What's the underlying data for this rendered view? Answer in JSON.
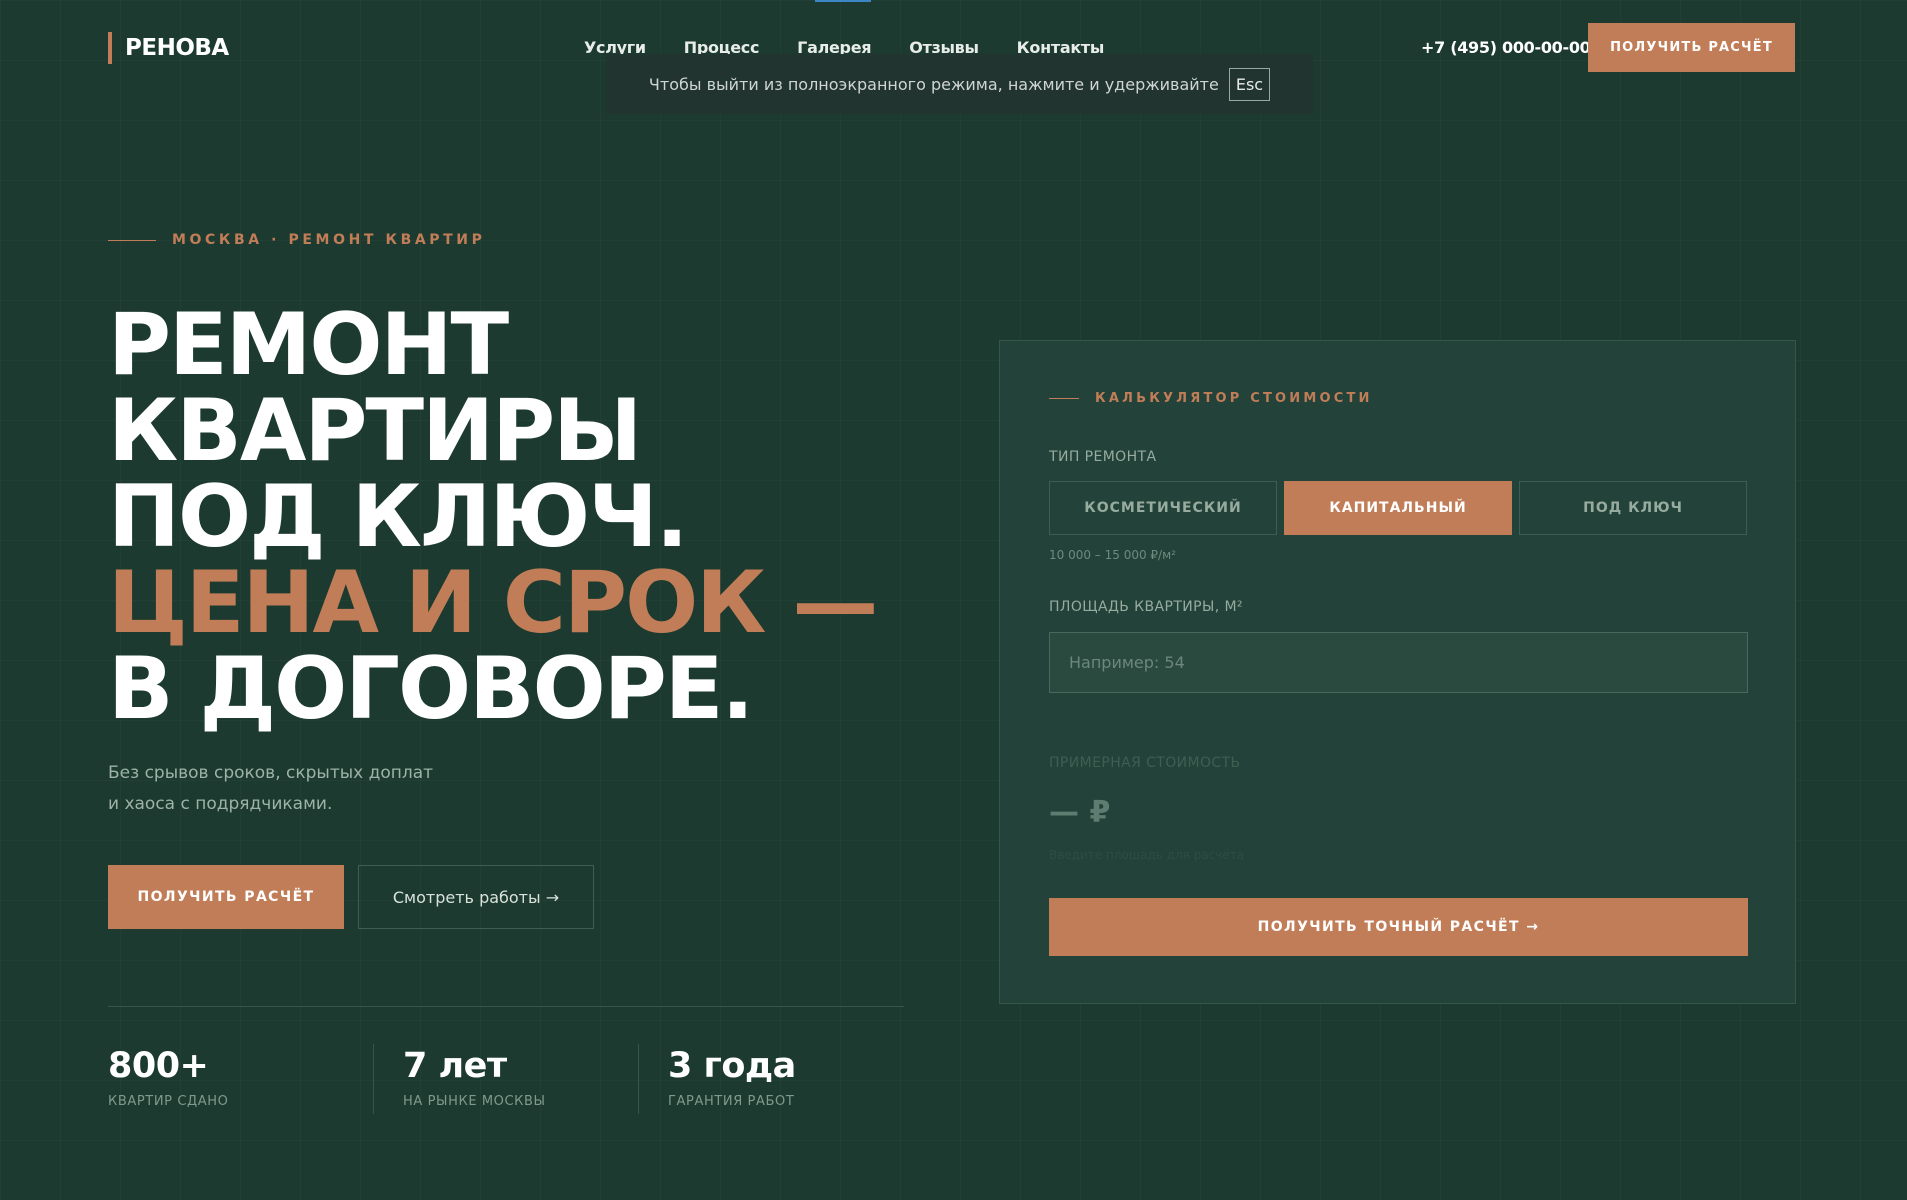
{
  "header": {
    "logo": "РЕНОВА",
    "nav": [
      "Услуги",
      "Процесс",
      "Галерея",
      "Отзывы",
      "Контакты"
    ],
    "phone": "+7 (495) 000-00-00",
    "cta_label": "получить расчёт"
  },
  "fullscreen_notice": {
    "text": "Чтобы выйти из полноэкранного режима, нажмите и удерживайте",
    "key": "Esc"
  },
  "hero": {
    "eyebrow": "Москва · ремонт квартир",
    "headline_lines": [
      "Ремонт",
      "квартиры",
      "под ключ."
    ],
    "headline_accent": "Цена и срок —",
    "headline_last": "в договоре.",
    "subtitle_line1": "Без срывов сроков, скрытых доплат",
    "subtitle_line2": "и хаоса с подрядчиками.",
    "primary_button": "получить расчёт",
    "secondary_button": "Смотреть работы →"
  },
  "stats": [
    {
      "value": "800+",
      "label": "квартир сдано"
    },
    {
      "value": "7 лет",
      "label": "на рынке Москвы"
    },
    {
      "value": "3 года",
      "label": "гарантия работ"
    }
  ],
  "calculator": {
    "eyebrow": "калькулятор стоимости",
    "type_label": "Тип ремонта",
    "types": [
      "косметический",
      "капитальный",
      "под ключ"
    ],
    "selected_type": "капитальный",
    "price_range": "10 000 – 15 000 ₽/м²",
    "area_label": "Площадь квартиры, м²",
    "area_placeholder": "Например: 54",
    "estimate_label": "Примерная стоимость",
    "estimate_value": "— ₽",
    "estimate_hint": "Введите площадь для расчёта",
    "submit_label": "получить точный расчёт →"
  },
  "colors": {
    "background": "#1c3a2f",
    "accent": "#c17d57",
    "panel": "#22423a"
  }
}
